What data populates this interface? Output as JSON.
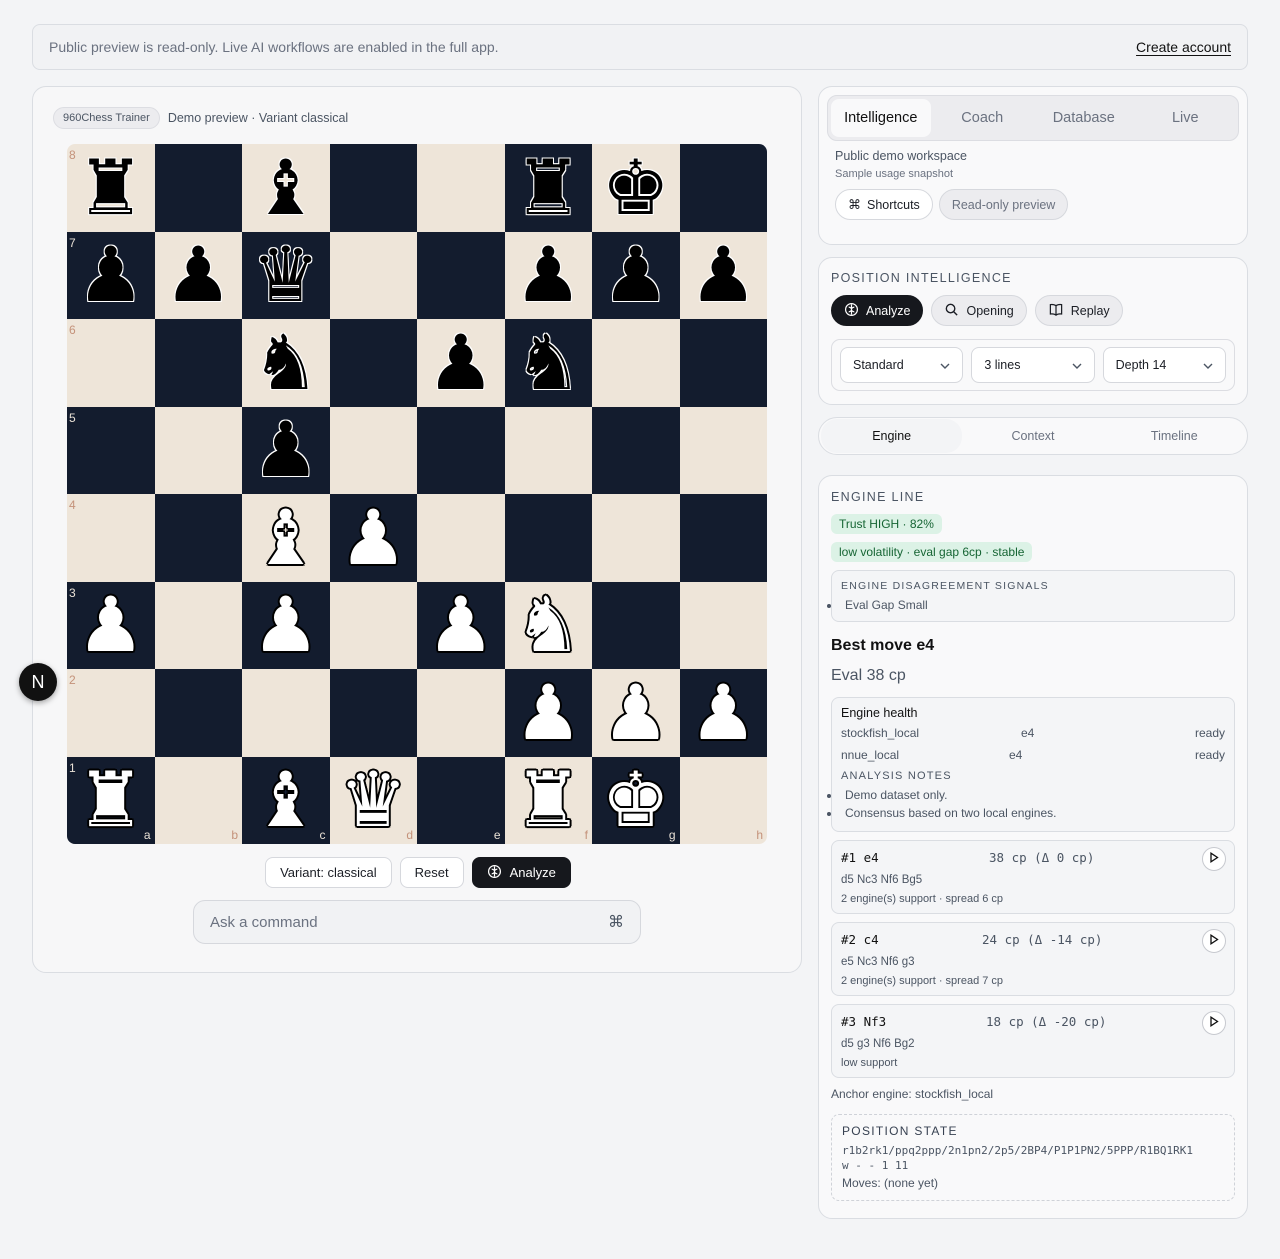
{
  "banner": {
    "text": "Public preview is read-only. Live AI workflows are enabled in the full app.",
    "link": "Create account"
  },
  "board_header": {
    "tag": "960Chess Trainer",
    "subtitle": "Demo preview · Variant classical"
  },
  "board": {
    "ranks": [
      "8",
      "7",
      "6",
      "5",
      "4",
      "3",
      "2",
      "1"
    ],
    "files": [
      "a",
      "b",
      "c",
      "d",
      "e",
      "f",
      "g",
      "h"
    ],
    "squares": [
      [
        "r",
        "",
        "b",
        "",
        "",
        "r",
        "k",
        ""
      ],
      [
        "p",
        "p",
        "q",
        "",
        "",
        "p",
        "p",
        "p"
      ],
      [
        "",
        "",
        "n",
        "",
        "p",
        "n",
        "",
        ""
      ],
      [
        "",
        "",
        "p",
        "",
        "",
        "",
        "",
        ""
      ],
      [
        "",
        "",
        "B",
        "P",
        "",
        "",
        "",
        ""
      ],
      [
        "P",
        "",
        "P",
        "",
        "P",
        "N",
        "",
        ""
      ],
      [
        "",
        "",
        "",
        "",
        "",
        "P",
        "P",
        "P"
      ],
      [
        "R",
        "",
        "B",
        "Q",
        "",
        "R",
        "K",
        ""
      ]
    ],
    "colors": {
      "light": "#eee5d9",
      "dark": "#131c2e"
    }
  },
  "board_actions": {
    "variant_button": "Variant: classical",
    "reset_button": "Reset",
    "analyze_button": "Analyze"
  },
  "ask": {
    "placeholder": "Ask a command",
    "shortcut": "⌘"
  },
  "n_badge": "N",
  "workspace": {
    "tabs": [
      "Intelligence",
      "Coach",
      "Database",
      "Live"
    ],
    "active_tab": "Intelligence",
    "title": "Public demo workspace",
    "subtitle": "Sample usage snapshot",
    "shortcuts_button": "Shortcuts",
    "readonly_button": "Read-only preview"
  },
  "position_intelligence": {
    "label": "POSITION INTELLIGENCE",
    "buttons": [
      "Analyze",
      "Opening",
      "Replay"
    ],
    "selects": [
      "Standard",
      "3 lines",
      "Depth 14"
    ]
  },
  "subtabs": {
    "items": [
      "Engine",
      "Context",
      "Timeline"
    ],
    "active": "Engine"
  },
  "engine_line": {
    "label": "ENGINE LINE",
    "trust_badge": "Trust HIGH · 82%",
    "volatility_badge": "low volatility · eval gap 6cp · stable",
    "disagreement_label": "ENGINE DISAGREEMENT SIGNALS",
    "disagreement_item": "Eval Gap Small",
    "best_move": "Best move e4",
    "eval": "Eval 38 cp",
    "health": {
      "title": "Engine health",
      "rows": [
        {
          "engine": "stockfish_local",
          "move": "e4",
          "status": "ready"
        },
        {
          "engine": "nnue_local",
          "move": "e4",
          "status": "ready"
        }
      ],
      "notes_label": "ANALYSIS NOTES",
      "notes": [
        "Demo dataset only.",
        "Consensus based on two local engines."
      ]
    },
    "lines": [
      {
        "head": "#1 e4",
        "eval": "38 cp (Δ 0 cp)",
        "pv": "d5 Nc3 Nf6 Bg5",
        "support": "2 engine(s) support · spread 6 cp"
      },
      {
        "head": "#2 c4",
        "eval": "24 cp (Δ -14 cp)",
        "pv": "e5 Nc3 Nf6 g3",
        "support": "2 engine(s) support · spread 7 cp"
      },
      {
        "head": "#3 Nf3",
        "eval": "18 cp (Δ -20 cp)",
        "pv": "d5 g3 Nf6 Bg2",
        "support": "low support"
      }
    ],
    "anchor": "Anchor engine: stockfish_local"
  },
  "position_state": {
    "label": "POSITION STATE",
    "fen_line1": "r1b2rk1/ppq2ppp/2n1pn2/2p5/2BP4/P1P1PN2/5PPP/R1BQ1RK1",
    "fen_line2": "w - - 1 11",
    "moves": "Moves: (none yet)"
  }
}
